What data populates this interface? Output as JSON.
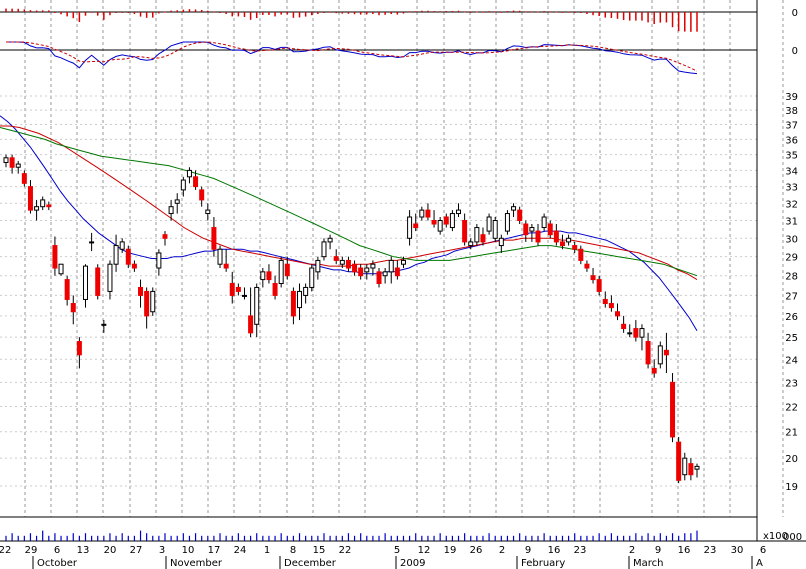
{
  "chart_data": {
    "type": "candlestick",
    "title": "",
    "price_axis": {
      "ticks": [
        19,
        20,
        21,
        22,
        23,
        24,
        25,
        26,
        27,
        28,
        29,
        30,
        31,
        32,
        33,
        34,
        35,
        36,
        37,
        38,
        39
      ],
      "scale": "log",
      "ylim": [
        18.5,
        39.5
      ]
    },
    "oscillator_axis": {
      "ticks": [
        "0",
        "0"
      ]
    },
    "volume_axis": {
      "label": "x100",
      "tick": "000"
    },
    "date_ticks": [
      "22",
      "29",
      "6",
      "13",
      "20",
      "27",
      "3",
      "10",
      "17",
      "24",
      "1",
      "8",
      "15",
      "22",
      "5",
      "12",
      "19",
      "26",
      "2",
      "9",
      "16",
      "23",
      "2",
      "9",
      "16",
      "23",
      "30",
      "6"
    ],
    "month_labels": [
      "October",
      "November",
      "December",
      "2009",
      "February",
      "March",
      "A"
    ],
    "candles": [
      [
        34.5,
        35.0,
        34.2,
        34.8
      ],
      [
        34.8,
        35.0,
        33.8,
        34.2
      ],
      [
        34.2,
        34.6,
        33.8,
        34.4
      ],
      [
        33.8,
        34.0,
        33.0,
        33.2
      ],
      [
        33.0,
        33.4,
        31.4,
        31.6
      ],
      [
        31.6,
        32.2,
        31.0,
        31.8
      ],
      [
        31.8,
        32.4,
        31.6,
        32.2
      ],
      [
        31.9,
        32.1,
        31.6,
        31.8
      ],
      [
        29.6,
        30.1,
        28.0,
        28.4
      ],
      [
        28.1,
        28.6,
        28.0,
        28.6
      ],
      [
        27.8,
        28.0,
        26.5,
        26.8
      ],
      [
        26.6,
        27.0,
        25.6,
        26.2
      ],
      [
        24.8,
        25.0,
        23.6,
        24.2
      ],
      [
        26.8,
        28.6,
        26.4,
        28.5
      ],
      [
        29.8,
        30.3,
        29.3,
        29.8
      ],
      [
        28.4,
        28.6,
        26.8,
        27.0
      ],
      [
        25.6,
        25.8,
        25.2,
        25.6
      ],
      [
        27.2,
        28.8,
        26.8,
        28.6
      ],
      [
        28.6,
        30.2,
        28.2,
        29.6
      ],
      [
        29.4,
        30.0,
        29.2,
        29.8
      ],
      [
        29.4,
        29.6,
        28.4,
        28.6
      ],
      [
        28.6,
        28.8,
        28.2,
        28.4
      ],
      [
        27.4,
        27.8,
        26.4,
        27.0
      ],
      [
        27.2,
        27.4,
        25.4,
        26.0
      ],
      [
        26.2,
        27.4,
        26.0,
        27.2
      ],
      [
        28.4,
        29.4,
        28.0,
        29.2
      ],
      [
        30.2,
        30.4,
        29.6,
        30.0
      ],
      [
        31.4,
        32.2,
        31.0,
        31.8
      ],
      [
        32.0,
        32.6,
        31.4,
        32.2
      ],
      [
        32.8,
        33.6,
        32.4,
        33.4
      ],
      [
        33.6,
        34.2,
        33.2,
        34.0
      ],
      [
        33.6,
        34.0,
        32.8,
        33.0
      ],
      [
        32.8,
        33.0,
        31.8,
        32.2
      ],
      [
        31.4,
        32.0,
        31.0,
        31.6
      ],
      [
        30.6,
        31.2,
        29.0,
        29.4
      ],
      [
        28.6,
        29.6,
        28.4,
        29.4
      ],
      [
        28.6,
        29.4,
        28.2,
        28.4
      ],
      [
        27.6,
        28.2,
        26.6,
        27.0
      ],
      [
        27.4,
        27.6,
        27.0,
        27.2
      ],
      [
        27.0,
        27.4,
        26.8,
        27.0
      ],
      [
        26.0,
        27.4,
        25.0,
        25.2
      ],
      [
        25.6,
        27.6,
        25.0,
        27.4
      ],
      [
        27.8,
        28.4,
        27.4,
        28.2
      ],
      [
        28.2,
        28.6,
        27.6,
        27.8
      ],
      [
        27.6,
        28.0,
        26.8,
        27.0
      ],
      [
        27.6,
        29.0,
        27.4,
        28.8
      ],
      [
        28.6,
        29.0,
        27.8,
        28.0
      ],
      [
        27.2,
        27.4,
        25.6,
        26.0
      ],
      [
        26.4,
        27.6,
        25.8,
        27.2
      ],
      [
        27.0,
        27.6,
        26.6,
        27.4
      ],
      [
        27.4,
        28.6,
        27.2,
        28.4
      ],
      [
        28.2,
        29.0,
        27.8,
        28.8
      ],
      [
        29.0,
        30.0,
        28.8,
        29.8
      ],
      [
        29.8,
        30.2,
        29.4,
        30.0
      ],
      [
        29.0,
        29.4,
        28.6,
        28.8
      ],
      [
        28.6,
        29.0,
        28.4,
        28.8
      ],
      [
        28.8,
        29.0,
        28.2,
        28.4
      ],
      [
        28.6,
        28.8,
        28.0,
        28.2
      ],
      [
        28.4,
        28.6,
        27.8,
        28.0
      ],
      [
        28.2,
        28.6,
        27.8,
        28.4
      ],
      [
        28.4,
        28.8,
        28.0,
        28.6
      ],
      [
        28.2,
        28.4,
        27.4,
        27.6
      ],
      [
        28.0,
        28.4,
        27.6,
        28.2
      ],
      [
        28.2,
        29.0,
        27.6,
        28.8
      ],
      [
        28.4,
        28.8,
        27.8,
        28.0
      ],
      [
        28.6,
        29.0,
        28.4,
        28.8
      ],
      [
        30.0,
        31.6,
        29.6,
        31.2
      ],
      [
        30.8,
        31.4,
        30.4,
        30.6
      ],
      [
        31.2,
        31.8,
        31.0,
        31.6
      ],
      [
        31.6,
        32.0,
        31.0,
        31.2
      ],
      [
        31.0,
        31.6,
        30.6,
        30.8
      ],
      [
        30.4,
        31.2,
        30.2,
        31.0
      ],
      [
        31.2,
        31.4,
        30.6,
        30.8
      ],
      [
        30.6,
        31.6,
        30.4,
        31.4
      ],
      [
        31.4,
        32.0,
        31.2,
        31.6
      ],
      [
        31.0,
        31.4,
        29.6,
        29.8
      ],
      [
        29.6,
        30.0,
        29.4,
        29.8
      ],
      [
        29.8,
        30.8,
        29.6,
        30.6
      ],
      [
        30.2,
        30.6,
        29.6,
        29.8
      ],
      [
        30.4,
        31.4,
        30.2,
        31.2
      ],
      [
        30.0,
        31.2,
        29.8,
        31.0
      ],
      [
        29.6,
        30.2,
        29.2,
        30.0
      ],
      [
        30.4,
        31.6,
        30.2,
        31.4
      ],
      [
        31.6,
        32.0,
        31.2,
        31.8
      ],
      [
        31.6,
        31.8,
        30.8,
        31.0
      ],
      [
        30.8,
        31.0,
        29.8,
        30.2
      ],
      [
        30.4,
        30.8,
        29.8,
        30.6
      ],
      [
        30.4,
        30.8,
        29.6,
        29.8
      ],
      [
        30.6,
        31.4,
        30.4,
        31.2
      ],
      [
        30.8,
        31.0,
        30.0,
        30.2
      ],
      [
        30.4,
        30.8,
        29.6,
        29.8
      ],
      [
        29.8,
        30.2,
        29.4,
        29.6
      ],
      [
        29.8,
        30.2,
        29.6,
        30.0
      ],
      [
        29.6,
        29.8,
        29.2,
        29.4
      ],
      [
        29.4,
        29.6,
        28.6,
        28.8
      ],
      [
        28.6,
        28.8,
        28.2,
        28.4
      ],
      [
        28.0,
        28.4,
        27.6,
        27.8
      ],
      [
        27.8,
        28.0,
        27.0,
        27.2
      ],
      [
        26.8,
        27.2,
        26.4,
        26.6
      ],
      [
        26.6,
        27.0,
        26.2,
        26.4
      ],
      [
        26.2,
        26.6,
        25.8,
        26.0
      ],
      [
        25.6,
        26.0,
        25.2,
        25.4
      ],
      [
        25.2,
        25.6,
        25.0,
        25.2
      ],
      [
        25.4,
        25.8,
        24.8,
        25.0
      ],
      [
        25.0,
        25.6,
        24.4,
        25.4
      ],
      [
        24.8,
        25.2,
        23.6,
        23.8
      ],
      [
        23.6,
        24.0,
        23.2,
        23.4
      ],
      [
        23.8,
        24.8,
        23.6,
        24.6
      ],
      [
        24.4,
        25.2,
        23.4,
        24.2
      ],
      [
        23.0,
        23.4,
        20.6,
        20.8
      ],
      [
        20.6,
        20.8,
        19.1,
        19.2
      ],
      [
        19.4,
        20.2,
        19.2,
        20.0
      ],
      [
        19.8,
        20.0,
        19.2,
        19.4
      ],
      [
        19.6,
        19.8,
        19.3,
        19.7
      ]
    ],
    "series": [
      {
        "name": "",
        "color": "#0000cc",
        "values": [
          37.6,
          37.2,
          36.7,
          36.1,
          35.5,
          34.8,
          34.1,
          33.4,
          32.7,
          32.1,
          31.6,
          31.1,
          30.7,
          30.3,
          30.0,
          29.7,
          29.4,
          29.2,
          29.1,
          29.0,
          28.9,
          28.9,
          28.9,
          29.0,
          29.0,
          29.1,
          29.2,
          29.3,
          29.3,
          29.4,
          29.4,
          29.4,
          29.4,
          29.3,
          29.3,
          29.2,
          29.1,
          29.0,
          28.9,
          28.8,
          28.7,
          28.6,
          28.5,
          28.4,
          28.3,
          28.3,
          28.2,
          28.2,
          28.1,
          28.1,
          28.1,
          28.2,
          28.2,
          28.3,
          28.4,
          28.6,
          28.7,
          28.9,
          29.0,
          29.1,
          29.3,
          29.4,
          29.5,
          29.6,
          29.7,
          29.8,
          29.9,
          30.0,
          30.1,
          30.2,
          30.3,
          30.3,
          30.4,
          30.4,
          30.4,
          30.3,
          30.3,
          30.2,
          30.1,
          30.0,
          29.9,
          29.7,
          29.5,
          29.3,
          29.0,
          28.7,
          28.3,
          27.9,
          27.4,
          26.9,
          26.4,
          25.9,
          25.3
        ]
      },
      {
        "name": "",
        "color": "#cc0000",
        "values": [
          36.9,
          36.9,
          36.8,
          36.6,
          36.4,
          36.1,
          35.8,
          35.4,
          35.0,
          34.6,
          34.2,
          33.8,
          33.4,
          33.0,
          32.6,
          32.2,
          31.8,
          31.4,
          31.0,
          30.6,
          30.3,
          30.0,
          29.8,
          29.6,
          29.4,
          29.3,
          29.2,
          29.1,
          29.0,
          28.9,
          28.8,
          28.7,
          28.6,
          28.6,
          28.5,
          28.5,
          28.5,
          28.6,
          28.6,
          28.7,
          28.8,
          28.8,
          28.9,
          29.0,
          29.1,
          29.2,
          29.3,
          29.4,
          29.5,
          29.6,
          29.7,
          29.8,
          29.9,
          29.9,
          30.0,
          30.0,
          30.0,
          30.0,
          29.9,
          29.9,
          29.8,
          29.7,
          29.6,
          29.5,
          29.4,
          29.3,
          29.2,
          29.0,
          28.8,
          28.6,
          28.3,
          28.1,
          27.8
        ]
      },
      {
        "name": "",
        "color": "#007700",
        "values": [
          36.8,
          36.6,
          36.4,
          36.2,
          36.0,
          35.7,
          35.5,
          35.3,
          35.1,
          34.9,
          34.8,
          34.7,
          34.6,
          34.5,
          34.4,
          34.3,
          34.1,
          33.9,
          33.7,
          33.5,
          33.2,
          32.9,
          32.6,
          32.3,
          32.0,
          31.7,
          31.4,
          31.1,
          30.8,
          30.5,
          30.2,
          29.9,
          29.6,
          29.4,
          29.2,
          29.0,
          28.9,
          28.8,
          28.8,
          28.8,
          28.8,
          28.9,
          29.0,
          29.1,
          29.2,
          29.3,
          29.4,
          29.5,
          29.6,
          29.6,
          29.5,
          29.4,
          29.3,
          29.2,
          29.1,
          29.0,
          28.9,
          28.8,
          28.7,
          28.6,
          28.4,
          28.2,
          28.0
        ]
      }
    ],
    "histogram_note": "",
    "volume": [
      2,
      3,
      2,
      2,
      3,
      2,
      4,
      2,
      3,
      2,
      2,
      3,
      2,
      3,
      2,
      2,
      2,
      3,
      2,
      3,
      2,
      2,
      4,
      3,
      2,
      2,
      3,
      2,
      2,
      3,
      2,
      3,
      2,
      2,
      2,
      3,
      2,
      2,
      3,
      2,
      2,
      3,
      2,
      2,
      2,
      3,
      2,
      2,
      3,
      2,
      2,
      2,
      3,
      2,
      2,
      2,
      3,
      2,
      3,
      2,
      2,
      2,
      3,
      2,
      2,
      2,
      2,
      3,
      2,
      2,
      2,
      3,
      2,
      2,
      2,
      3,
      2,
      2,
      2,
      3,
      2,
      2,
      2,
      2,
      3,
      2,
      2,
      2,
      3,
      2,
      2,
      2,
      2,
      3,
      2,
      2,
      2,
      3,
      2,
      3,
      2,
      2,
      2,
      3,
      2,
      3,
      2,
      3,
      2,
      3,
      2,
      3,
      3,
      4,
      3,
      5,
      3,
      2,
      2,
      2
    ],
    "colors": {
      "up": "#ffffff",
      "down": "#ee0000",
      "grid": "#999999"
    }
  }
}
